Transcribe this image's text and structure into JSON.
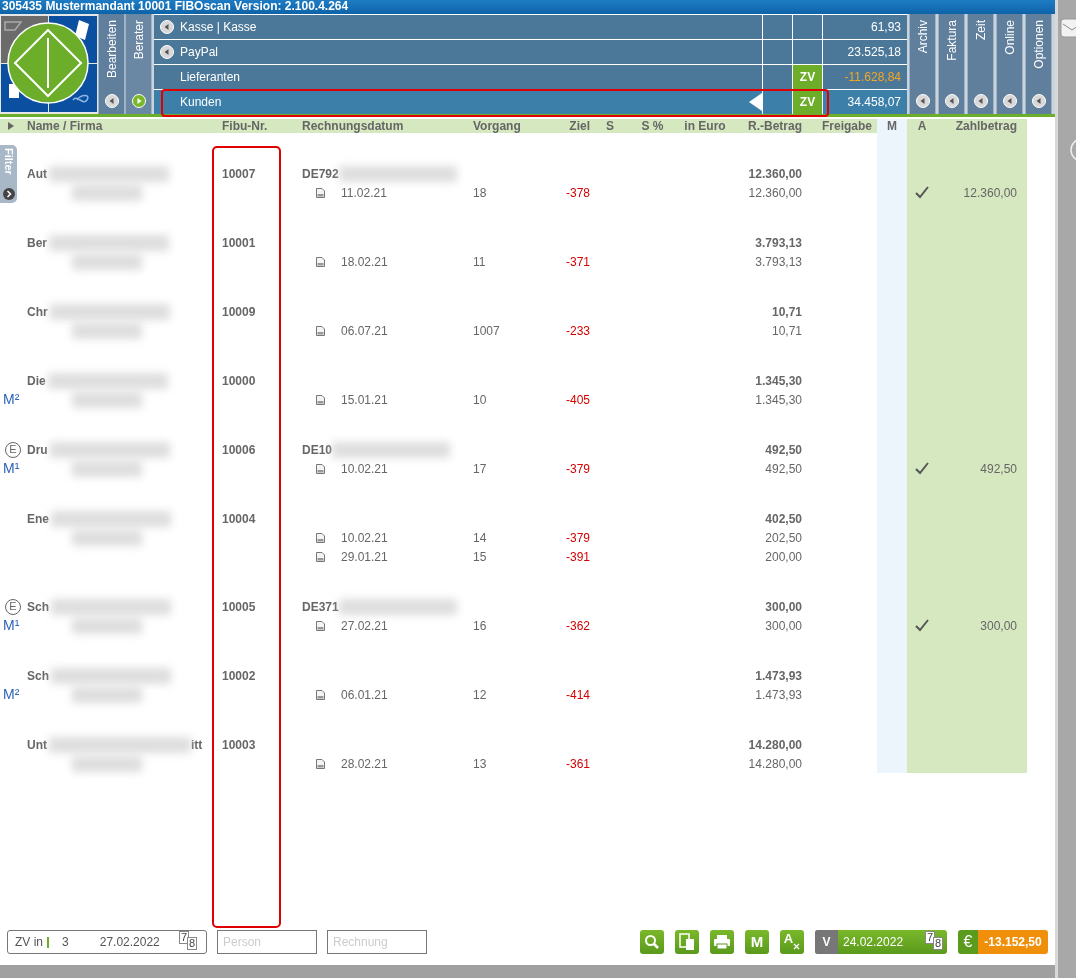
{
  "title": "305435 Mustermandant 10001 FIBOscan Version: 2.100.4.264",
  "side_tabs": [
    {
      "label": "Bearbeiten",
      "active": false
    },
    {
      "label": "Berater",
      "active": true
    }
  ],
  "accounts": [
    {
      "label": "Kasse | Kasse",
      "has_arrow": true,
      "amount": "61,93",
      "negative": false,
      "selected": false
    },
    {
      "label": "PayPal",
      "has_arrow": true,
      "amount": "23.525,18",
      "negative": false,
      "selected": false
    },
    {
      "label": "Lieferanten",
      "has_arrow": false,
      "zv": "ZV",
      "amount": "-11.628,84",
      "negative": true,
      "selected": false
    },
    {
      "label": "Kunden",
      "has_arrow": false,
      "zv": "ZV",
      "amount": "34.458,07",
      "negative": false,
      "selected": true
    }
  ],
  "right_tabs": [
    "Archiv",
    "Faktura",
    "Zeit",
    "Online",
    "Optionen"
  ],
  "filter_tab": "Filter",
  "columns": [
    "Name / Firma",
    "Fibu-Nr.",
    "Rechnungsdatum",
    "Vorgang",
    "Ziel",
    "S",
    "S %",
    "in Euro",
    "R.-Betrag",
    "Freigabe",
    "M",
    "A",
    "Zahlbetrag"
  ],
  "customers": [
    {
      "name": "Aut",
      "fibu": "10007",
      "ustid": "DE792",
      "total": "12.360,00",
      "invoices": [
        {
          "date": "11.02.21",
          "vorgang": "18",
          "ziel": "-378",
          "betrag": "12.360,00",
          "approved": true,
          "zahlbetrag": "12.360,00"
        }
      ]
    },
    {
      "name": "Ber",
      "fibu": "10001",
      "total": "3.793,13",
      "invoices": [
        {
          "date": "18.02.21",
          "vorgang": "11",
          "ziel": "-371",
          "betrag": "3.793,13",
          "approved": false
        }
      ]
    },
    {
      "name": "Chr",
      "fibu": "10009",
      "total": "10,71",
      "invoices": [
        {
          "date": "06.07.21",
          "vorgang": "1007",
          "ziel": "-233",
          "betrag": "10,71",
          "approved": false
        }
      ]
    },
    {
      "name": "Die",
      "m_badge": "M²",
      "fibu": "10000",
      "total": "1.345,30",
      "invoices": [
        {
          "date": "15.01.21",
          "vorgang": "10",
          "ziel": "-405",
          "betrag": "1.345,30",
          "approved": false
        }
      ]
    },
    {
      "name": "Dru",
      "e_badge": "E",
      "m_badge": "M¹",
      "fibu": "10006",
      "ustid": "DE10",
      "total": "492,50",
      "invoices": [
        {
          "date": "10.02.21",
          "vorgang": "17",
          "ziel": "-379",
          "betrag": "492,50",
          "approved": true,
          "zahlbetrag": "492,50"
        }
      ]
    },
    {
      "name": "Ene",
      "fibu": "10004",
      "total": "402,50",
      "invoices": [
        {
          "date": "10.02.21",
          "vorgang": "14",
          "ziel": "-379",
          "betrag": "202,50",
          "approved": false
        },
        {
          "date": "29.01.21",
          "vorgang": "15",
          "ziel": "-391",
          "betrag": "200,00",
          "approved": false
        }
      ]
    },
    {
      "name": "Sch",
      "e_badge": "E",
      "m_badge": "M¹",
      "fibu": "10005",
      "ustid": "DE371",
      "total": "300,00",
      "invoices": [
        {
          "date": "27.02.21",
          "vorgang": "16",
          "ziel": "-362",
          "betrag": "300,00",
          "approved": true,
          "zahlbetrag": "300,00"
        }
      ]
    },
    {
      "name": "Sch",
      "m_badge": "M²",
      "fibu": "10002",
      "total": "1.473,93",
      "invoices": [
        {
          "date": "06.01.21",
          "vorgang": "12",
          "ziel": "-414",
          "betrag": "1.473,93",
          "approved": false
        }
      ]
    },
    {
      "name": "Unt",
      "name_end": "itt",
      "fibu": "10003",
      "total": "14.280,00",
      "invoices": [
        {
          "date": "28.02.21",
          "vorgang": "13",
          "ziel": "-361",
          "betrag": "14.280,00",
          "approved": false
        }
      ]
    }
  ],
  "bottom": {
    "zv_label": "ZV in",
    "zv_count": "3",
    "zv_date": "27.02.2022",
    "calendar_digits": [
      "7",
      "8"
    ],
    "person_placeholder": "Person",
    "rechnung_placeholder": "Rechnung",
    "toolbar": [
      {
        "kind": "search"
      },
      {
        "kind": "copy"
      },
      {
        "kind": "print"
      },
      {
        "kind": "letter",
        "label": "M"
      },
      {
        "kind": "clear",
        "label": "A"
      }
    ],
    "date_prefix": "V",
    "date": "24.02.2022",
    "date_calendar_digits": [
      "7",
      "8"
    ],
    "currency": "€",
    "sum": "-13.152,50"
  }
}
